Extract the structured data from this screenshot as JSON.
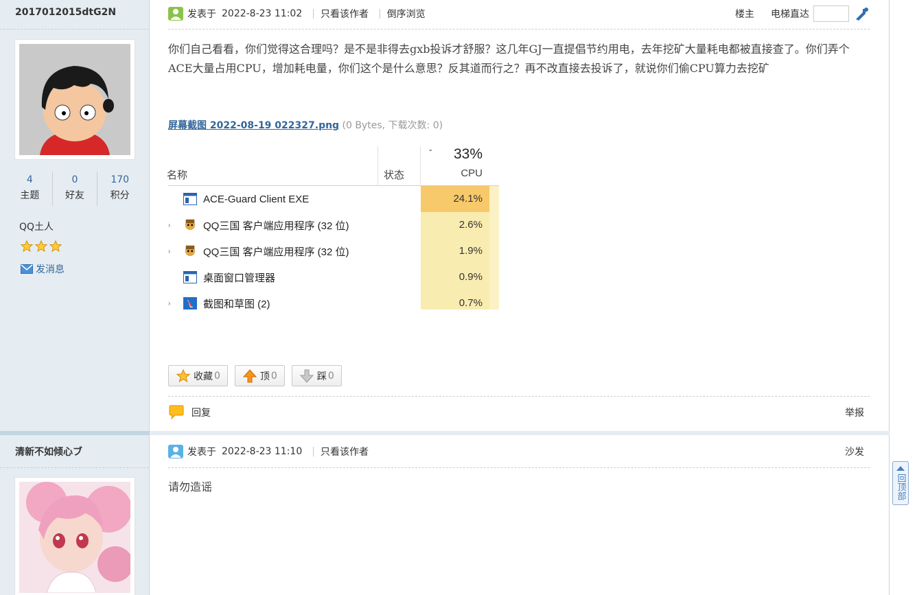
{
  "posts": [
    {
      "author": {
        "name": "2017012015dtG2N",
        "stats": [
          {
            "num": "4",
            "label": "主题"
          },
          {
            "num": "0",
            "label": "好友"
          },
          {
            "num": "170",
            "label": "积分"
          }
        ],
        "group": "QQ土人",
        "stars": 3,
        "send_message": "发消息"
      },
      "header": {
        "posted_prefix": "发表于",
        "datetime": "2022-8-23 11:02",
        "only_author": "只看该作者",
        "reverse": "倒序浏览",
        "floor": "楼主",
        "jump_label": "电梯直达"
      },
      "content": "你们自己看看，你们觉得这合理吗？是不是非得去gxb投诉才舒服？这几年GJ一直提倡节约用电，去年挖矿大量耗电都被直接查了。你们弄个ACE大量占用CPU，增加耗电量，你们这个是什么意思？反其道而行之？再不改直接去投诉了，就说你们偷CPU算力去挖矿",
      "attachment": {
        "name": "屏幕截图 2022-08-19 022327.png",
        "meta": "(0 Bytes, 下载次数: 0)"
      },
      "task_manager": {
        "col_name": "名称",
        "col_status": "状态",
        "cpu_total": "33%",
        "col_cpu": "CPU",
        "rows": [
          {
            "name": "ACE-Guard Client EXE",
            "cpu": "24.1%",
            "expand": false,
            "icon": "window-icon"
          },
          {
            "name": "QQ三国 客户端应用程序 (32 位)",
            "cpu": "2.6%",
            "expand": true,
            "icon": "qq-sanguo-icon"
          },
          {
            "name": "QQ三国 客户端应用程序 (32 位)",
            "cpu": "1.9%",
            "expand": true,
            "icon": "qq-sanguo-icon"
          },
          {
            "name": "桌面窗口管理器",
            "cpu": "0.9%",
            "expand": false,
            "icon": "window-icon"
          },
          {
            "name": "截图和草图 (2)",
            "cpu": "0.7%",
            "expand": true,
            "icon": "snip-sketch-icon"
          }
        ]
      },
      "actions": [
        {
          "label": "收藏",
          "count": "0",
          "icon": "star-icon"
        },
        {
          "label": "顶",
          "count": "0",
          "icon": "up-arrow-icon"
        },
        {
          "label": "踩",
          "count": "0",
          "icon": "down-arrow-icon"
        }
      ],
      "reply": "回复",
      "report": "举报"
    },
    {
      "author": {
        "name": "清新不如倾心ブ"
      },
      "header": {
        "posted_prefix": "发表于",
        "datetime": "2022-8-23 11:10",
        "only_author": "只看该作者",
        "floor": "沙发"
      },
      "content": "请勿造谣"
    }
  ],
  "gotop": "回顶部",
  "colors": {
    "sidebar_bg": "#e5edf2",
    "link": "#336699",
    "cpu_highlight": "#f7c96a",
    "cpu_column": "#f9ecb0"
  }
}
